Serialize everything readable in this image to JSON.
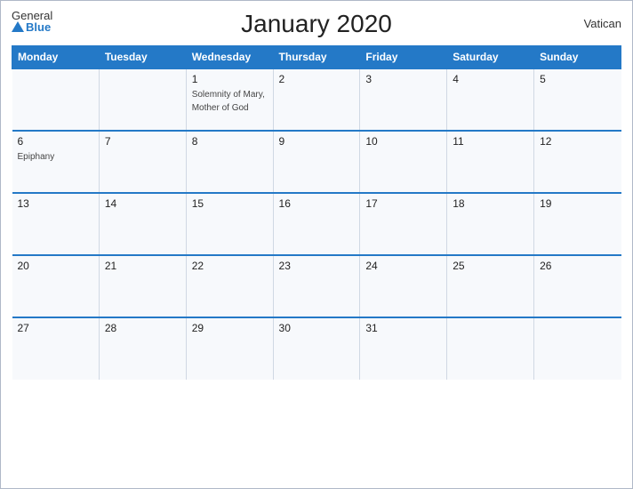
{
  "header": {
    "title": "January 2020",
    "country": "Vatican",
    "logo": {
      "general": "General",
      "blue": "Blue"
    }
  },
  "weekdays": [
    "Monday",
    "Tuesday",
    "Wednesday",
    "Thursday",
    "Friday",
    "Saturday",
    "Sunday"
  ],
  "weeks": [
    [
      {
        "day": "",
        "event": "",
        "empty": true
      },
      {
        "day": "",
        "event": "",
        "empty": true
      },
      {
        "day": "1",
        "event": "Solemnity of Mary, Mother of God",
        "empty": false
      },
      {
        "day": "2",
        "event": "",
        "empty": false
      },
      {
        "day": "3",
        "event": "",
        "empty": false
      },
      {
        "day": "4",
        "event": "",
        "empty": false
      },
      {
        "day": "5",
        "event": "",
        "empty": false
      }
    ],
    [
      {
        "day": "6",
        "event": "Epiphany",
        "empty": false
      },
      {
        "day": "7",
        "event": "",
        "empty": false
      },
      {
        "day": "8",
        "event": "",
        "empty": false
      },
      {
        "day": "9",
        "event": "",
        "empty": false
      },
      {
        "day": "10",
        "event": "",
        "empty": false
      },
      {
        "day": "11",
        "event": "",
        "empty": false
      },
      {
        "day": "12",
        "event": "",
        "empty": false
      }
    ],
    [
      {
        "day": "13",
        "event": "",
        "empty": false
      },
      {
        "day": "14",
        "event": "",
        "empty": false
      },
      {
        "day": "15",
        "event": "",
        "empty": false
      },
      {
        "day": "16",
        "event": "",
        "empty": false
      },
      {
        "day": "17",
        "event": "",
        "empty": false
      },
      {
        "day": "18",
        "event": "",
        "empty": false
      },
      {
        "day": "19",
        "event": "",
        "empty": false
      }
    ],
    [
      {
        "day": "20",
        "event": "",
        "empty": false
      },
      {
        "day": "21",
        "event": "",
        "empty": false
      },
      {
        "day": "22",
        "event": "",
        "empty": false
      },
      {
        "day": "23",
        "event": "",
        "empty": false
      },
      {
        "day": "24",
        "event": "",
        "empty": false
      },
      {
        "day": "25",
        "event": "",
        "empty": false
      },
      {
        "day": "26",
        "event": "",
        "empty": false
      }
    ],
    [
      {
        "day": "27",
        "event": "",
        "empty": false
      },
      {
        "day": "28",
        "event": "",
        "empty": false
      },
      {
        "day": "29",
        "event": "",
        "empty": false
      },
      {
        "day": "30",
        "event": "",
        "empty": false
      },
      {
        "day": "31",
        "event": "",
        "empty": false
      },
      {
        "day": "",
        "event": "",
        "empty": true
      },
      {
        "day": "",
        "event": "",
        "empty": true
      }
    ]
  ]
}
